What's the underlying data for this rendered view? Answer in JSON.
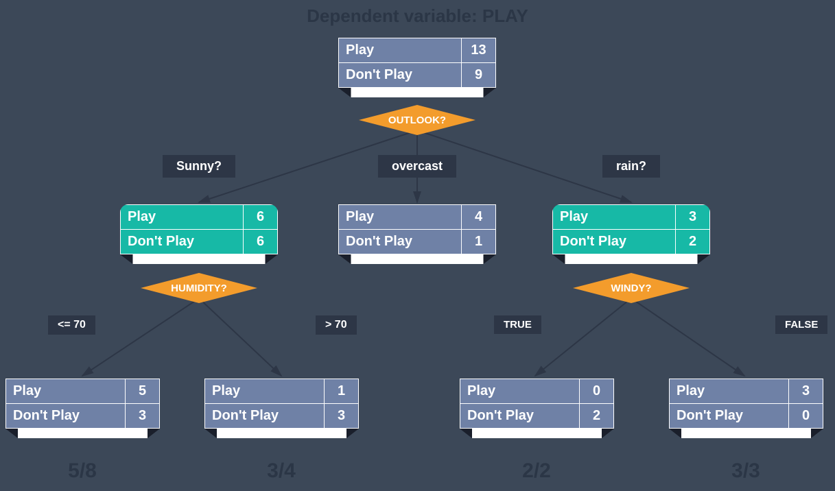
{
  "title": "Dependent variable: PLAY",
  "labels": {
    "play": "Play",
    "dont": "Don't Play"
  },
  "decisions": {
    "outlook": "OUTLOOK?",
    "humidity": "HUMIDITY?",
    "windy": "WINDY?"
  },
  "branches": {
    "sunny": "Sunny?",
    "overcast": "overcast",
    "rain": "rain?",
    "le70": "<= 70",
    "gt70": "> 70",
    "true": "TRUE",
    "false": "FALSE"
  },
  "root": {
    "play": "13",
    "dont": "9"
  },
  "sunny": {
    "play": "6",
    "dont": "6"
  },
  "overcast_node": {
    "play": "4",
    "dont": "1"
  },
  "rain_node": {
    "play": "3",
    "dont": "2"
  },
  "le70_node": {
    "play": "5",
    "dont": "3"
  },
  "gt70_node": {
    "play": "1",
    "dont": "3"
  },
  "true_node": {
    "play": "0",
    "dont": "2"
  },
  "false_node": {
    "play": "3",
    "dont": "0"
  },
  "ratios": {
    "r1": "5/8",
    "r2": "3/4",
    "r3": "2/2",
    "r4": "3/3"
  }
}
